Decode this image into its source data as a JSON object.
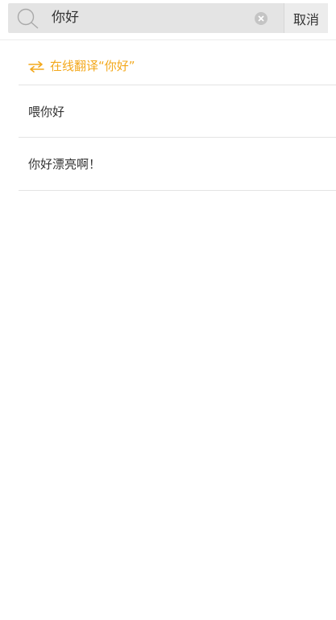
{
  "search": {
    "value": "你好",
    "cancel_label": "取消"
  },
  "translate": {
    "label": "在线翻译“你好”",
    "icon": "swap-arrows-icon",
    "color": "#f3a81c"
  },
  "suggestions": [
    {
      "text": "喂你好"
    },
    {
      "text": "你好漂亮啊！"
    }
  ]
}
